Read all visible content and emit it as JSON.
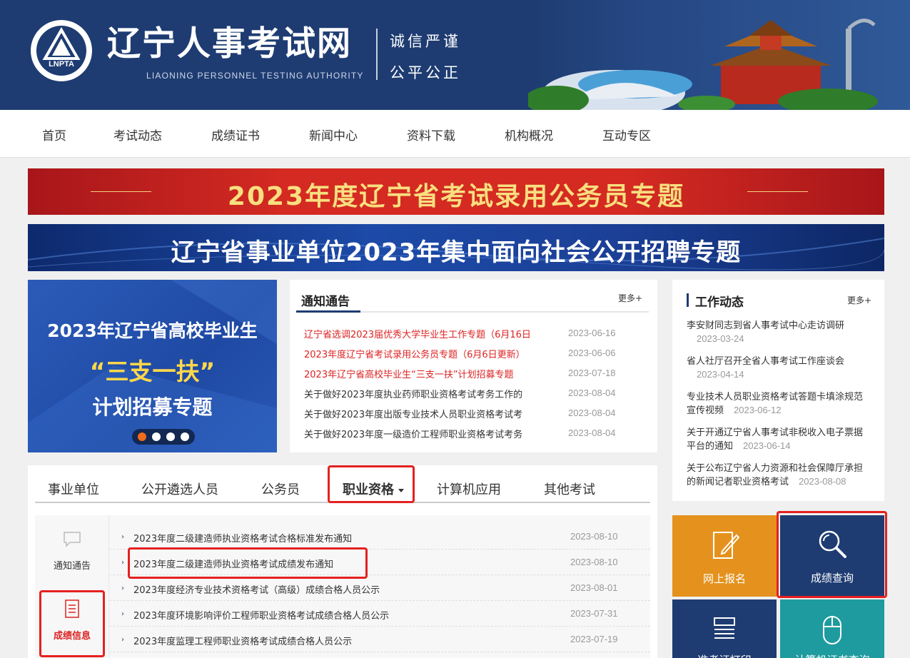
{
  "header": {
    "logo_text": "LNPTA",
    "title": "辽宁人事考试网",
    "subtitle": "LIAONING PERSONNEL TESTING AUTHORITY",
    "slogan_line1": "诚信严谨",
    "slogan_line2": "公平公正"
  },
  "nav": {
    "items": [
      "首页",
      "考试动态",
      "成绩证书",
      "新闻中心",
      "资料下载",
      "机构概况",
      "互动专区"
    ]
  },
  "banners": {
    "red": "2023年度辽宁省考试录用公务员专题",
    "blue": "辽宁省事业单位2023年集中面向社会公开招聘专题"
  },
  "carousel": {
    "line1": "2023年辽宁省高校毕业生",
    "line2": "“三支一扶”",
    "line3": "计划招募专题",
    "slide_count": 4,
    "active_index": 0
  },
  "notice": {
    "title": "通知通告",
    "more": "更多+",
    "items": [
      {
        "text": "辽宁省选调2023届优秀大学毕业生工作专题（6月16日",
        "date": "2023-06-16",
        "highlight": true
      },
      {
        "text": "2023年度辽宁省考试录用公务员专题（6月6日更新）",
        "date": "2023-06-06",
        "highlight": true
      },
      {
        "text": "2023年辽宁省高校毕业生“三支一扶”计划招募专题",
        "date": "2023-07-18",
        "highlight": true
      },
      {
        "text": "关于做好2023年度执业药师职业资格考试考务工作的",
        "date": "2023-08-04",
        "highlight": false
      },
      {
        "text": "关于做好2023年度出版专业技术人员职业资格考试考",
        "date": "2023-08-04",
        "highlight": false
      },
      {
        "text": "关于做好2023年度一级造价工程师职业资格考试考务",
        "date": "2023-08-04",
        "highlight": false
      }
    ]
  },
  "work": {
    "title": "工作动态",
    "more": "更多+",
    "items": [
      {
        "line1": "李安财同志到省人事考试中心走访调研",
        "line2": "",
        "date": "2023-03-24"
      },
      {
        "line1": "省人社厅召开全省人事考试工作座谈会",
        "line2": "",
        "date": "2023-04-14"
      },
      {
        "line1": "专业技术人员职业资格考试答题卡填涂规范",
        "line2": "宣传视频",
        "date": "2023-06-12"
      },
      {
        "line1": "关于开通辽宁省人事考试非税收入电子票据",
        "line2": "平台的通知",
        "date": "2023-06-14"
      },
      {
        "line1": "关于公布辽宁省人力资源和社会保障厅承担",
        "line2": "的新闻记者职业资格考试",
        "date": "2023-08-08"
      }
    ]
  },
  "tabs": {
    "items": [
      "事业单位",
      "公开遴选人员",
      "公务员",
      "职业资格",
      "计算机应用",
      "其他考试"
    ],
    "active": "职业资格"
  },
  "side": {
    "items": [
      {
        "label": "通知通告",
        "icon": "speech-bubble-icon"
      },
      {
        "label": "成绩信息",
        "icon": "document-icon"
      }
    ],
    "active": "成绩信息"
  },
  "list": {
    "items": [
      {
        "text": "2023年度二级建造师执业资格考试合格标准发布通知",
        "date": "2023-08-10"
      },
      {
        "text": "2023年度二级建造师执业资格考试成绩发布通知",
        "date": "2023-08-10"
      },
      {
        "text": "2023年度经济专业技术资格考试（高级）成绩合格人员公示",
        "date": "2023-08-01"
      },
      {
        "text": "2023年度环境影响评价工程师职业资格考试成绩合格人员公示",
        "date": "2023-07-31"
      },
      {
        "text": "2023年度监理工程师职业资格考试成绩合格人员公示",
        "date": "2023-07-19"
      }
    ]
  },
  "tiles": {
    "register": {
      "label": "网上报名",
      "icon": "pencil-note-icon",
      "color": "#e4921d"
    },
    "score": {
      "label": "成绩查询",
      "icon": "magnifier-icon",
      "color": "#1e3c72"
    },
    "t3": {
      "label": "准考证打印",
      "icon": "printer-icon",
      "color": "#1e3c72"
    },
    "t4": {
      "label": "计算机证书查询",
      "icon": "mouse-icon",
      "color": "#1e9b9e"
    }
  },
  "colors": {
    "header_blue": "#1e3c72",
    "accent_red": "#d22222",
    "highlight_red": "#e52020"
  }
}
